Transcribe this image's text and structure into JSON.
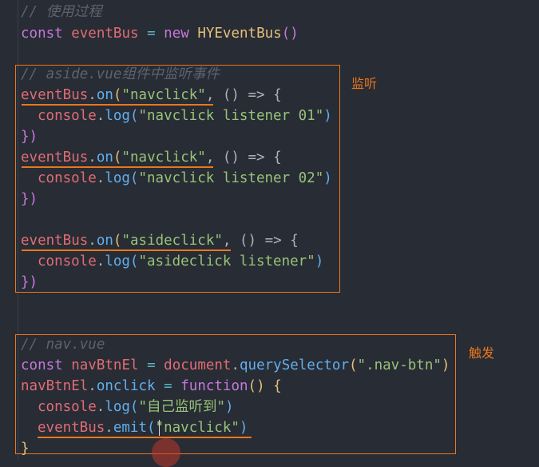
{
  "code": {
    "c1": "// 使用过程",
    "l2": {
      "kw": "const",
      "var": "eventBus",
      "op": "=",
      "kw2": "new",
      "cls": "HYEventBus",
      "paren": "()"
    },
    "c2": "// aside.vue组件中监听事件",
    "l4": {
      "obj": "eventBus",
      "dot": ".",
      "fn": "on",
      "p": "(",
      "str": "\"navclick\"",
      "rest": ", () => {"
    },
    "l5": {
      "obj": "console",
      "dot": ".",
      "fn": "log",
      "p": "(",
      "str": "\"navclick listener 01\"",
      "end": ")"
    },
    "l6": "})",
    "l7": {
      "obj": "eventBus",
      "dot": ".",
      "fn": "on",
      "p": "(",
      "str": "\"navclick\"",
      "rest": ", () => {"
    },
    "l8": {
      "obj": "console",
      "dot": ".",
      "fn": "log",
      "p": "(",
      "str": "\"navclick listener 02\"",
      "end": ")"
    },
    "l9": "})",
    "l10": {
      "obj": "eventBus",
      "dot": ".",
      "fn": "on",
      "p": "(",
      "str": "\"asideclick\"",
      "rest": ", () => {"
    },
    "l11": {
      "obj": "console",
      "dot": ".",
      "fn": "log",
      "p": "(",
      "str": "\"asideclick listener\"",
      "end": ")"
    },
    "l12": "})",
    "c3": "// nav.vue",
    "l14": {
      "kw": "const",
      "var": "navBtnEl",
      "op": "=",
      "obj": "document",
      "fn": "querySelector",
      "str": "\".nav-btn\""
    },
    "l15": {
      "obj": "navBtnEl",
      "prop": "onclick",
      "op": "=",
      "kw": "function",
      "rest": "() {"
    },
    "l16": {
      "obj": "console",
      "fn": "log",
      "str": "\"自己监听到\""
    },
    "l17": {
      "obj": "eventBus",
      "fn": "emit",
      "str": "\"navclick\""
    },
    "l18": "}"
  },
  "annotations": {
    "listen": "监听",
    "trigger": "触发"
  }
}
